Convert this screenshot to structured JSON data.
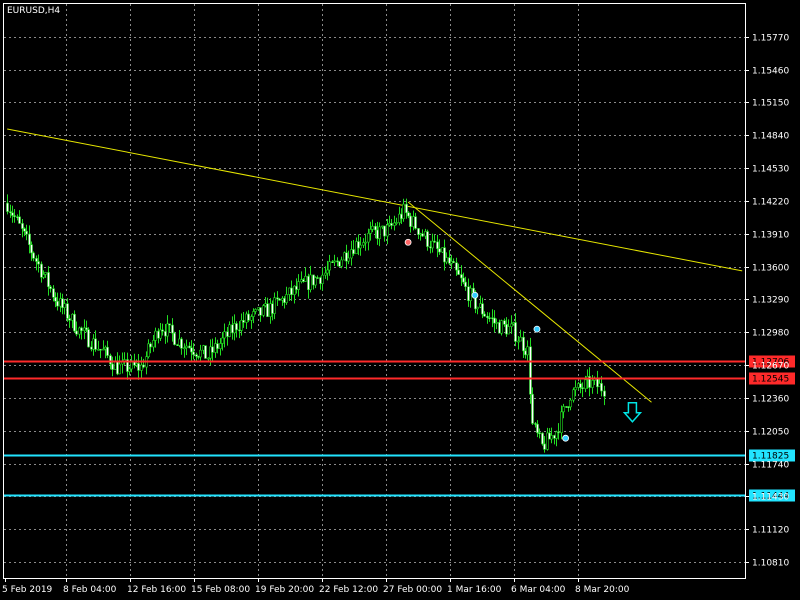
{
  "symbol_label": "EURUSD,H4",
  "chart_data": {
    "type": "candlestick",
    "title": "EURUSD,H4",
    "grid": true,
    "ylim": [
      1.1066,
      1.1608
    ],
    "yticks": [
      "1.15770",
      "1.15460",
      "1.15150",
      "1.14840",
      "1.14530",
      "1.14220",
      "1.13910",
      "1.13600",
      "1.13290",
      "1.12980",
      "1.12670",
      "1.12360",
      "1.12050",
      "1.11740",
      "1.11430",
      "1.11120",
      "1.10810"
    ],
    "xticks": [
      "5 Feb 2019",
      "8 Feb 04:00",
      "12 Feb 16:00",
      "15 Feb 08:00",
      "19 Feb 20:00",
      "22 Feb 12:00",
      "27 Feb 00:00",
      "1 Mar 16:00",
      "6 Mar 04:00",
      "8 Mar 20:00"
    ],
    "close_path": [
      [
        0,
        1.142
      ],
      [
        10,
        1.1375
      ],
      [
        20,
        1.133
      ],
      [
        30,
        1.13
      ],
      [
        40,
        1.128
      ],
      [
        46,
        1.1265
      ],
      [
        56,
        1.1265
      ],
      [
        64,
        1.1305
      ],
      [
        72,
        1.129
      ],
      [
        84,
        1.1275
      ],
      [
        96,
        1.1305
      ],
      [
        110,
        1.132
      ],
      [
        122,
        1.134
      ],
      [
        134,
        1.1355
      ],
      [
        145,
        1.138
      ],
      [
        152,
        1.139
      ],
      [
        160,
        1.1395
      ],
      [
        166,
        1.1412
      ],
      [
        176,
        1.1385
      ],
      [
        186,
        1.136
      ],
      [
        196,
        1.1325
      ],
      [
        205,
        1.1305
      ],
      [
        212,
        1.13
      ],
      [
        218,
        1.128
      ],
      [
        220,
        1.121
      ],
      [
        224,
        1.119
      ],
      [
        230,
        1.1205
      ],
      [
        236,
        1.124
      ],
      [
        244,
        1.125
      ],
      [
        250,
        1.1245
      ]
    ],
    "price_lines": [
      {
        "price": 1.12706,
        "label": "1.12706",
        "color": "#ff2a2a"
      },
      {
        "price": 1.12545,
        "label": "1.12545",
        "color": "#ff2a2a"
      },
      {
        "price": 1.11825,
        "label": "1.11825",
        "color": "#22e4ff"
      },
      {
        "price": 1.11444,
        "label": "1.11444",
        "color": "#22e4ff"
      }
    ],
    "trend_lines": [
      {
        "from": [
          0,
          1.149
        ],
        "to": [
          308,
          1.1356
        ],
        "color": "#e6e600"
      },
      {
        "from": [
          168,
          1.1421
        ],
        "to": [
          270,
          1.1232
        ],
        "color": "#e6e600"
      }
    ],
    "markers": [
      {
        "i": 168,
        "price": 1.1383,
        "color": "#ff6666"
      },
      {
        "i": 196,
        "price": 1.1333,
        "color": "#33ccff"
      },
      {
        "i": 222,
        "price": 1.1301,
        "color": "#33ccff"
      },
      {
        "i": 234,
        "price": 1.1198,
        "color": "#33ccff"
      }
    ],
    "signal_arrow": {
      "i": 262,
      "price": 1.1222,
      "direction": "down",
      "color": "#00e5e5"
    }
  }
}
